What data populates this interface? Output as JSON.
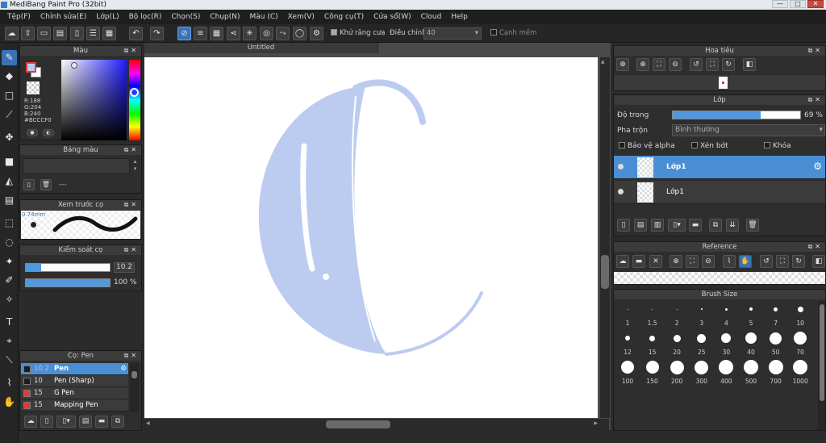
{
  "window": {
    "title": "MediBang Paint Pro (32bit)",
    "minimize": "—",
    "maximize": "□",
    "close": "✕"
  },
  "menu": [
    "Tệp(F)",
    "Chỉnh sửa(E)",
    "Lớp(L)",
    "Bộ lọc(R)",
    "Chọn(S)",
    "Chụp(N)",
    "Màu (C)",
    "Xem(V)",
    "Công cụ(T)",
    "Cửa sổ(W)",
    "Cloud",
    "Help"
  ],
  "toolbar": {
    "antialias_label": "Khử răng cưa",
    "antialias_checked": true,
    "correction_label": "Điều chỉnh",
    "correction_value": "40",
    "sharp_edge_label": "Cạnh mềm",
    "sharp_edge_checked": false
  },
  "color_panel": {
    "title": "Màu",
    "r": "R:188",
    "g": "G:204",
    "b": "B:240",
    "hex": "#BCCCF0",
    "current_color": "#bcccf0"
  },
  "palette_panel": {
    "title": "Bảng màu",
    "empty": "---"
  },
  "brush_preview_panel": {
    "title": "Xem trước cọ",
    "size": "0.74mm"
  },
  "brush_control_panel": {
    "title": "Kiểm soát cọ",
    "size_value": "10.2",
    "opacity_value": "100 %",
    "size_fraction": 0.18,
    "opacity_fraction": 1.0
  },
  "brush_list_panel": {
    "title": "Cọ: Pen",
    "items": [
      {
        "size": "10.2",
        "name": "Pen",
        "color": "#1c1c1c",
        "selected": true
      },
      {
        "size": "10",
        "name": "Pen (Sharp)",
        "color": "#1c1c1c",
        "selected": false
      },
      {
        "size": "15",
        "name": "G Pen",
        "color": "#e53935",
        "selected": false
      },
      {
        "size": "15",
        "name": "Mapping Pen",
        "color": "#e53935",
        "selected": false
      }
    ]
  },
  "canvas": {
    "document_tab": "Untitled",
    "stroke_color": "#bcccf0"
  },
  "navigator_panel": {
    "title": "Hoa tiêu"
  },
  "layer_panel": {
    "title": "Lớp",
    "opacity_label": "Độ trong",
    "opacity_value": "69 %",
    "opacity_fraction": 0.69,
    "blend_label": "Pha trộn",
    "blend_value": "Bình thường",
    "alpha_protect": "Bảo vệ alpha",
    "clipping": "Xén bớt",
    "lock": "Khóa",
    "layers": [
      {
        "name": "Lớp1",
        "selected": true
      },
      {
        "name": "Lớp1",
        "selected": false
      }
    ]
  },
  "reference_panel": {
    "title": "Reference"
  },
  "brush_size_panel": {
    "title": "Brush Size",
    "sizes": [
      "1",
      "1.5",
      "2",
      "3",
      "4",
      "5",
      "7",
      "10",
      "12",
      "15",
      "20",
      "25",
      "30",
      "40",
      "50",
      "70",
      "100",
      "150",
      "200",
      "300",
      "400",
      "500",
      "700",
      "1000"
    ]
  }
}
